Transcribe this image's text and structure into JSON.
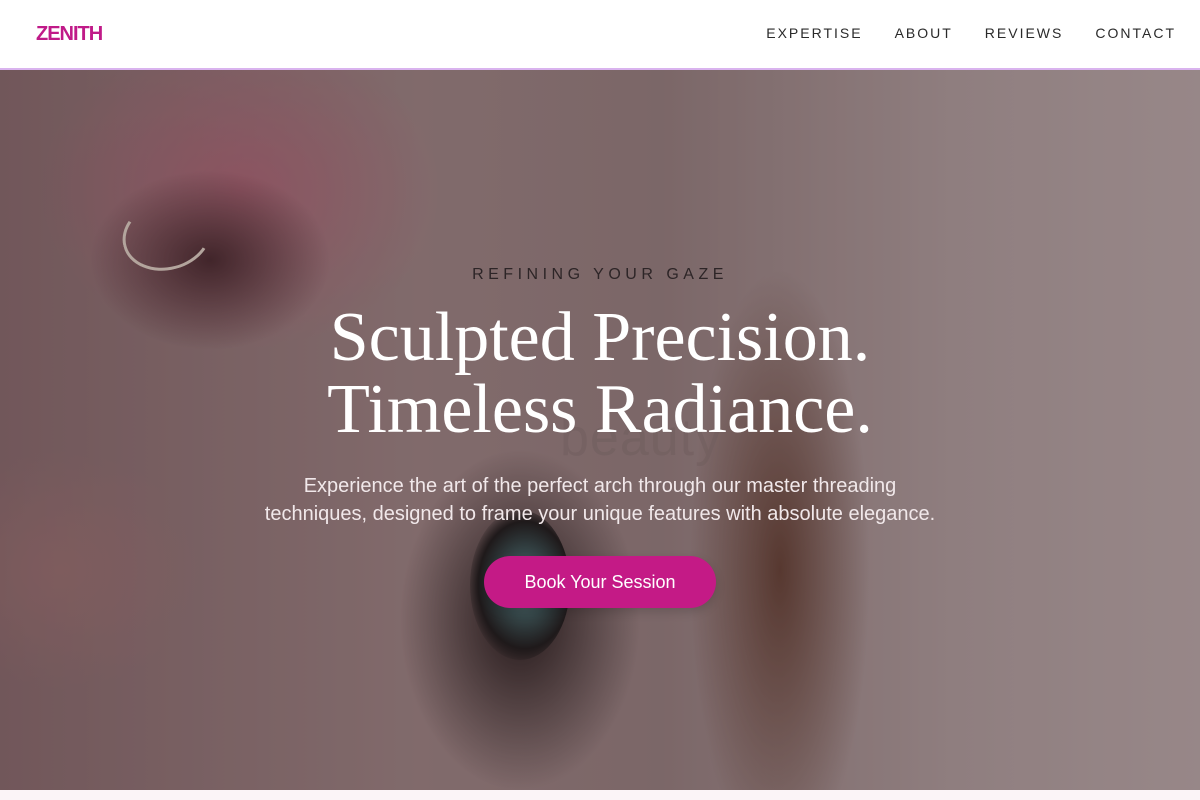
{
  "brand": {
    "name": "ZENITH",
    "color": "#c01a88"
  },
  "nav": {
    "items": [
      {
        "label": "EXPERTISE"
      },
      {
        "label": "ABOUT"
      },
      {
        "label": "REVIEWS"
      },
      {
        "label": "CONTACT"
      }
    ]
  },
  "hero": {
    "kicker": "REFINING YOUR GAZE",
    "headline_line1": "Sculpted Precision.",
    "headline_line2": "Timeless Radiance.",
    "subtext": "Experience the art of the perfect arch through our master threading techniques, designed to frame your unique features with absolute elegance.",
    "background_text": "beauty",
    "cta_label": "Book Your Session",
    "cta_color": "#c41a86"
  }
}
